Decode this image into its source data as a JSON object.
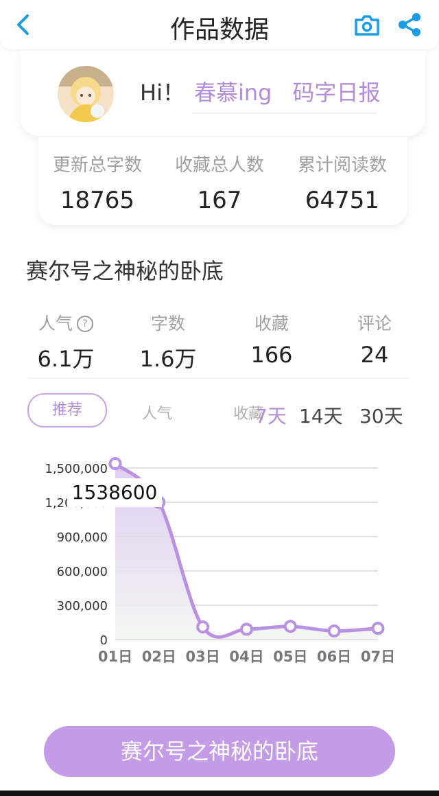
{
  "header": {
    "title": "作品数据",
    "back_icon": "chevron-left-icon",
    "camera_icon": "camera-icon",
    "share_icon": "share-icon",
    "accent": "#1a9be8"
  },
  "profile": {
    "greeting": "Hi！",
    "name": "春慕ing",
    "report_label": "码字日报"
  },
  "totals": [
    {
      "label": "更新总字数",
      "value": "18765"
    },
    {
      "label": "收藏总人数",
      "value": "167"
    },
    {
      "label": "累计阅读数",
      "value": "64751"
    }
  ],
  "work": {
    "title": "赛尔号之神秘的卧底",
    "stats": [
      {
        "label": "人气",
        "value": "6.1万"
      },
      {
        "label": "字数",
        "value": "1.6万"
      },
      {
        "label": "收藏",
        "value": "166"
      },
      {
        "label": "评论",
        "value": "24"
      }
    ]
  },
  "tabs": {
    "active": "推荐",
    "items": [
      "人气",
      "收藏"
    ]
  },
  "ranges": {
    "items": [
      "7天",
      "14天",
      "30天"
    ],
    "active": "7天"
  },
  "chart_data": {
    "type": "area",
    "x": [
      "01日",
      "02日",
      "03日",
      "04日",
      "05日",
      "06日",
      "07日"
    ],
    "series": [
      {
        "values": [
          1538600,
          1200000,
          110000,
          90000,
          115000,
          75000,
          98000
        ]
      }
    ],
    "ylim": [
      0,
      1500000
    ],
    "yticks": [
      "0",
      "300,000",
      "600,000",
      "900,000",
      "1,200,000",
      "1,500,000"
    ],
    "grid": true,
    "tooltip": "1538600",
    "color": "#b892e0"
  },
  "bottom_button": {
    "label": "赛尔号之神秘的卧底",
    "color": "#c39be6"
  }
}
